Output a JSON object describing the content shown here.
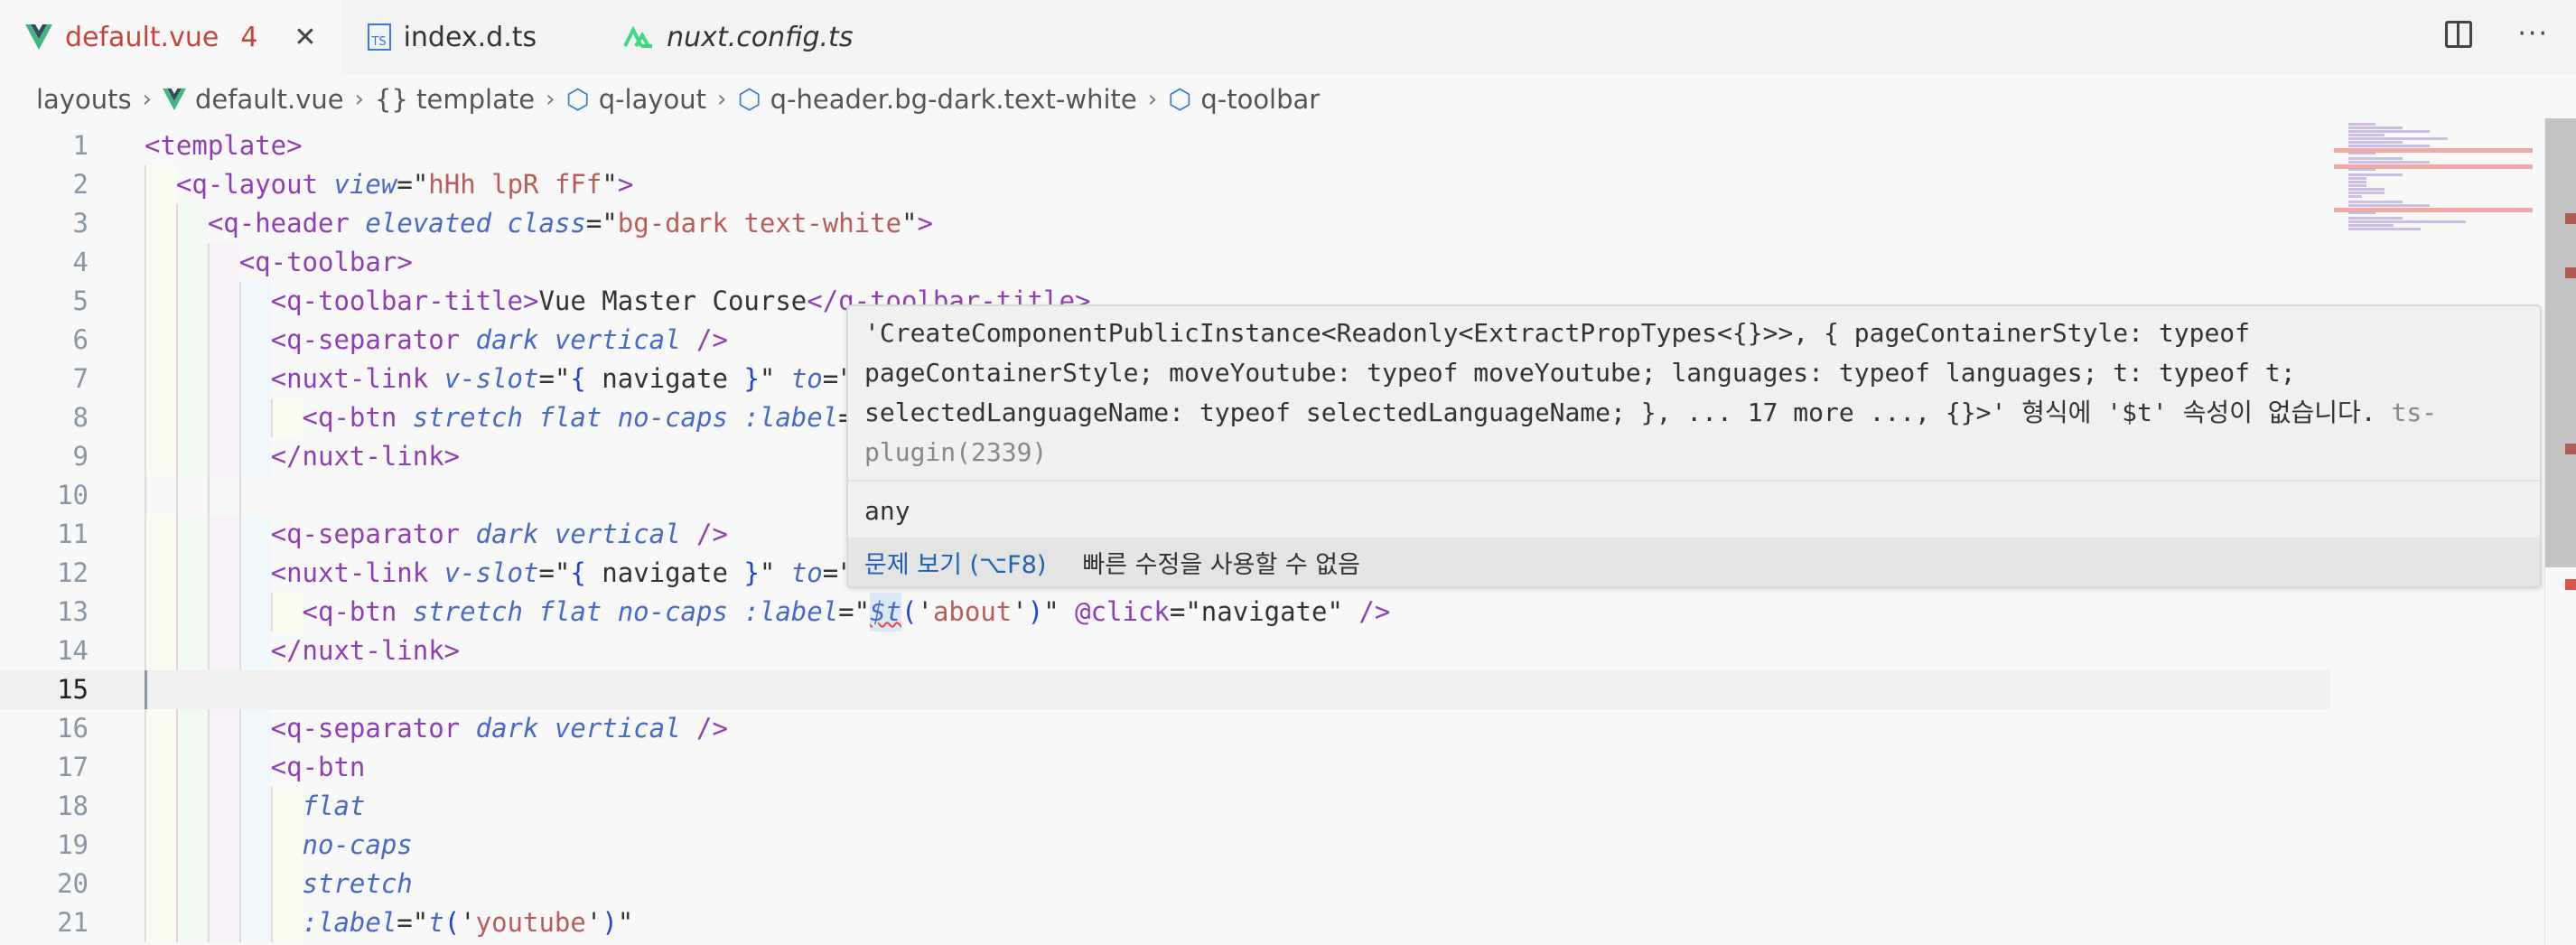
{
  "tabs": [
    {
      "label": "default.vue",
      "badge": "4",
      "icon": "vue-icon",
      "active": true,
      "close": "✕"
    },
    {
      "label": "index.d.ts",
      "icon": "typescript-icon",
      "active": false
    },
    {
      "label": "nuxt.config.ts",
      "icon": "nuxt-icon",
      "active": false,
      "italic": true
    }
  ],
  "actions": {
    "split": "split-editor-icon",
    "more": "···"
  },
  "breadcrumb": [
    "layouts",
    "default.vue",
    "{} template",
    "q-layout",
    "q-header.bg-dark.text-white",
    "q-toolbar"
  ],
  "editor": {
    "current_line": 15,
    "lines": [
      {
        "n": "1",
        "ind": 0,
        "tk": [
          [
            "t",
            "<template>"
          ]
        ]
      },
      {
        "n": "2",
        "ind": 1,
        "tk": [
          [
            "t",
            "<q-layout "
          ],
          [
            "a",
            "view"
          ],
          [
            "p",
            "=\""
          ],
          [
            "s",
            "hHh lpR fFf"
          ],
          [
            "p",
            "\""
          ],
          [
            "t",
            ">"
          ]
        ]
      },
      {
        "n": "3",
        "ind": 2,
        "tk": [
          [
            "t",
            "<q-header "
          ],
          [
            "a",
            "elevated class"
          ],
          [
            "p",
            "=\""
          ],
          [
            "s",
            "bg-dark text-white"
          ],
          [
            "p",
            "\""
          ],
          [
            "t",
            ">"
          ]
        ]
      },
      {
        "n": "4",
        "ind": 3,
        "tk": [
          [
            "t",
            "<q-toolbar>"
          ]
        ]
      },
      {
        "n": "5",
        "ind": 4,
        "tk": [
          [
            "t",
            "<q-toolbar-title>"
          ],
          [
            "p",
            "Vue Master Course"
          ],
          [
            "t",
            "</q-toolbar-title>"
          ]
        ]
      },
      {
        "n": "6",
        "ind": 4,
        "tk": [
          [
            "t",
            "<q-separator "
          ],
          [
            "a",
            "dark vertical "
          ],
          [
            "t",
            "/>"
          ]
        ]
      },
      {
        "n": "7",
        "ind": 4,
        "tk": [
          [
            "t",
            "<nuxt-link "
          ],
          [
            "a",
            "v-slot"
          ],
          [
            "p",
            "=\""
          ],
          [
            "b",
            "{"
          ],
          [
            "p",
            " navigate "
          ],
          [
            "b",
            "}"
          ],
          [
            "p",
            "\" "
          ],
          [
            "a",
            "to"
          ],
          [
            "p",
            "=\""
          ]
        ]
      },
      {
        "n": "8",
        "ind": 5,
        "tk": [
          [
            "t",
            "<q-btn "
          ],
          [
            "a",
            "stretch flat no-caps :label"
          ],
          [
            "p",
            "="
          ]
        ]
      },
      {
        "n": "9",
        "ind": 4,
        "tk": [
          [
            "t",
            "</nuxt-link>"
          ]
        ]
      },
      {
        "n": "10",
        "ind": 4,
        "blank": true,
        "tk": []
      },
      {
        "n": "11",
        "ind": 4,
        "tk": [
          [
            "t",
            "<q-separator "
          ],
          [
            "a",
            "dark vertical "
          ],
          [
            "t",
            "/>"
          ]
        ]
      },
      {
        "n": "12",
        "ind": 4,
        "tk": [
          [
            "t",
            "<nuxt-link "
          ],
          [
            "a",
            "v-slot"
          ],
          [
            "p",
            "=\""
          ],
          [
            "b",
            "{"
          ],
          [
            "p",
            " navigate "
          ],
          [
            "b",
            "}"
          ],
          [
            "p",
            "\" "
          ],
          [
            "a",
            "to"
          ],
          [
            "p",
            "=\""
          ]
        ]
      },
      {
        "n": "13",
        "ind": 5,
        "tk": [
          [
            "t",
            "<q-btn "
          ],
          [
            "a",
            "stretch flat no-caps :label"
          ],
          [
            "p",
            "=\""
          ],
          [
            "e",
            "$t"
          ],
          [
            "b",
            "("
          ],
          [
            "p",
            "'"
          ],
          [
            "s",
            "about"
          ],
          [
            "p",
            "'"
          ],
          [
            "b",
            ")"
          ],
          [
            "p",
            "\" "
          ],
          [
            "t",
            "@click"
          ],
          [
            "p",
            "=\"navigate\" "
          ],
          [
            "t",
            "/>"
          ]
        ]
      },
      {
        "n": "14",
        "ind": 4,
        "tk": [
          [
            "t",
            "</nuxt-link>"
          ]
        ]
      },
      {
        "n": "15",
        "ind": 0,
        "tk": []
      },
      {
        "n": "16",
        "ind": 4,
        "tk": [
          [
            "t",
            "<q-separator "
          ],
          [
            "a",
            "dark vertical "
          ],
          [
            "t",
            "/>"
          ]
        ]
      },
      {
        "n": "17",
        "ind": 4,
        "tk": [
          [
            "t",
            "<q-btn"
          ]
        ]
      },
      {
        "n": "18",
        "ind": 5,
        "tk": [
          [
            "a",
            "flat"
          ]
        ]
      },
      {
        "n": "19",
        "ind": 5,
        "tk": [
          [
            "a",
            "no-caps"
          ]
        ]
      },
      {
        "n": "20",
        "ind": 5,
        "tk": [
          [
            "a",
            "stretch"
          ]
        ]
      },
      {
        "n": "21",
        "ind": 5,
        "tk": [
          [
            "a",
            ":label"
          ],
          [
            "p",
            "=\""
          ],
          [
            "a",
            "t"
          ],
          [
            "b",
            "("
          ],
          [
            "p",
            "'"
          ],
          [
            "s",
            "youtube"
          ],
          [
            "p",
            "'"
          ],
          [
            "b",
            ")"
          ],
          [
            "p",
            "\""
          ]
        ]
      }
    ]
  },
  "hover": {
    "message": "'CreateComponentPublicInstance<Readonly<ExtractPropTypes<{}>>, { pageContainerStyle: typeof pageContainerStyle; moveYoutube: typeof moveYoutube; languages: typeof languages; t: typeof t; selectedLanguageName: typeof selectedLanguageName; }, ... 17 more ..., {}>' 형식에 '$t' 속성이 없습니다. ",
    "source": "ts-plugin(2339)",
    "type": "any",
    "view_problem": "문제 보기 (⌥F8)",
    "no_quick_fix": "빠른 수정을 사용할 수 없음"
  },
  "colors": {
    "error": "#e04a3b",
    "tag": "#8f3fb4",
    "attribute": "#4a68c8",
    "string": "#b85c5c"
  }
}
